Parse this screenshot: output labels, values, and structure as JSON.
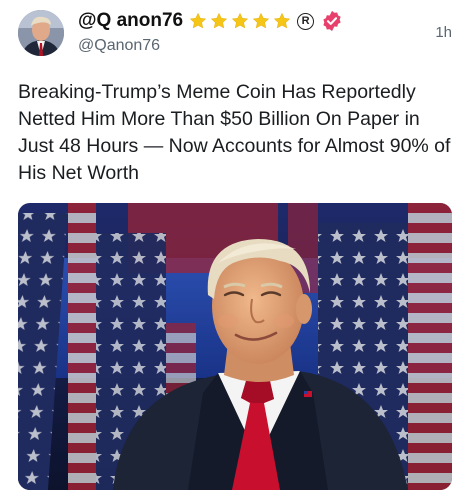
{
  "author": {
    "display_name": "@Q anon76",
    "handle": "@Qanon76",
    "badges": [
      "star-icon",
      "star-icon",
      "star-icon",
      "star-icon",
      "star-icon",
      "registered-icon",
      "verified-icon"
    ],
    "registered_symbol": "R"
  },
  "timestamp": "1h",
  "post_text": "Breaking-Trump’s Meme Coin Has Reportedly Netted Him More Than $50 Billion On Paper in Just 48 Hours — Now Accounts for Almost 90% of His Net Worth",
  "colors": {
    "star": "#f5c518",
    "verified": "#e8406c",
    "text": "#1b1e21",
    "muted": "#5b6670",
    "tie": "#c8102e",
    "suit": "#1c2436",
    "backdrop_blue": "#2b55c9"
  }
}
